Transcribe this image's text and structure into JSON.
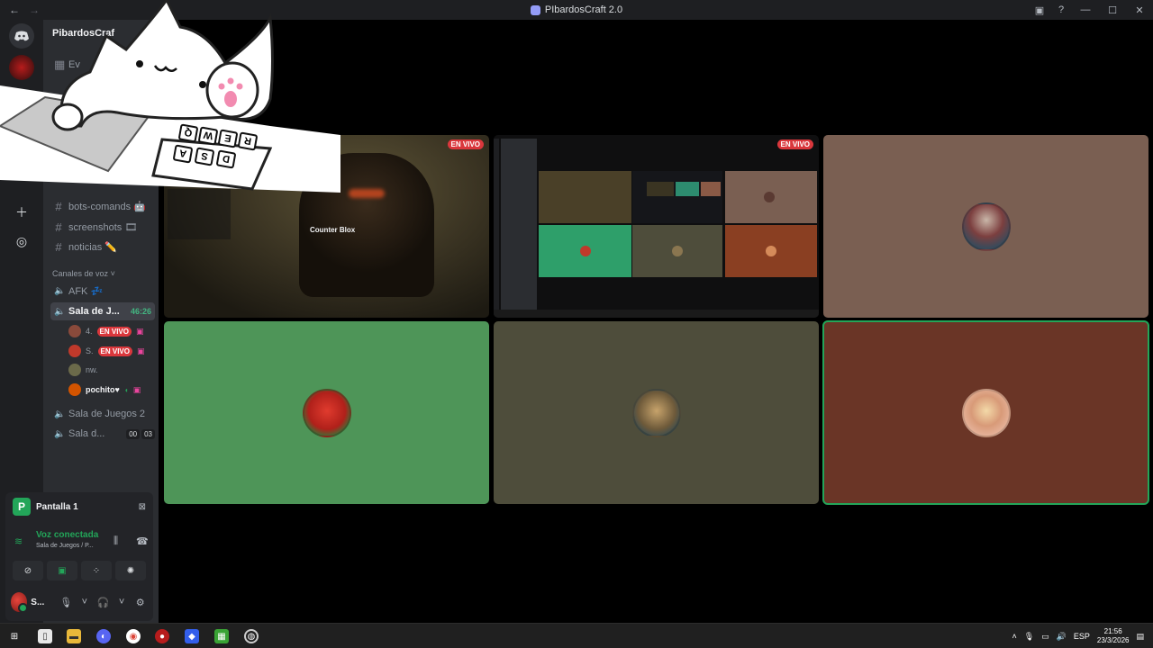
{
  "titlebar": {
    "back_icon": "arrow-left-icon",
    "forward_icon": "arrow-right-icon",
    "title": "PIbardosCraft 2.0",
    "controls": [
      "inbox-icon",
      "help-icon",
      "minimize-icon",
      "maximize-icon",
      "close-icon"
    ]
  },
  "rail": {
    "home_icon": "discord-logo-icon",
    "add_server_icon": "plus-icon",
    "explore_icon": "compass-icon"
  },
  "sidebar": {
    "server_name": "PibardosCraf",
    "events_label": "Ev",
    "text_channels": [
      {
        "name": "bots-comands 🤖"
      },
      {
        "name": "screenshots 🎞"
      },
      {
        "name": "noticias ✏️"
      }
    ],
    "voice_category": "Canales de voz",
    "voice_channels": [
      {
        "name": "AFK 💤"
      },
      {
        "name": "Sala de J...",
        "timer": "46:26"
      },
      {
        "name": "Sala de Juegos 2"
      },
      {
        "name": "Sala d...",
        "count_a": "00",
        "count_b": "03"
      }
    ],
    "voice_users": [
      {
        "name": "4.",
        "live": "EN VIVO",
        "color": "#8a4a3b"
      },
      {
        "name": "S.",
        "live": "EN VIVO",
        "color": "#c0392b"
      },
      {
        "name": "nw.",
        "live": "",
        "color": "#6b6a4a"
      },
      {
        "name": "pochito♥",
        "live": "",
        "color": "#d35400"
      }
    ]
  },
  "panel": {
    "screen_label": "Pantalla 1",
    "voice_status": "Voz conectada",
    "voice_channel": "Sala de Juegos / P...",
    "user_name": "S..."
  },
  "stage": {
    "live_badge": "EN VIVO",
    "game_title": "Counter Blox",
    "tiles": [
      {
        "id": "game-stream",
        "bg": "#3d3624"
      },
      {
        "id": "screen-stream",
        "bg": "#0f0f10"
      },
      {
        "id": "user-tile-3",
        "bg": "#7a5f52"
      },
      {
        "id": "user-tile-4",
        "bg": "#4e9558"
      },
      {
        "id": "user-tile-5",
        "bg": "#4e4d3b"
      },
      {
        "id": "user-tile-6",
        "bg": "#6a3526"
      }
    ]
  },
  "sticker": {
    "keys": [
      "Q",
      "W",
      "E",
      "R",
      "A",
      "S",
      "D"
    ]
  },
  "taskbar": {
    "language": "ESP",
    "time": "21:56",
    "date": "23/3/2026"
  }
}
